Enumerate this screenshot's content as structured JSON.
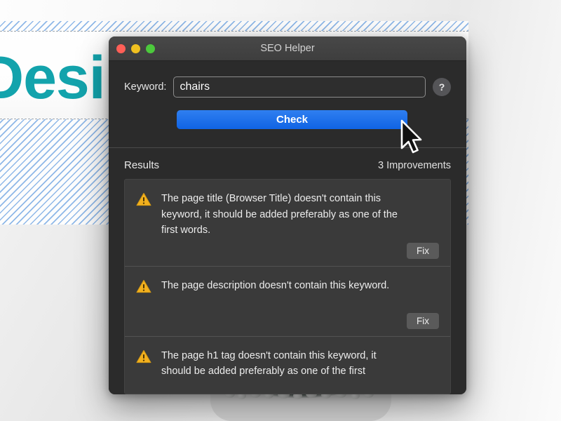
{
  "background": {
    "hero_text": "Desi",
    "brand_color": "#13a3ac",
    "stripe_color": "#8fb8e8"
  },
  "window": {
    "title": "SEO Helper",
    "traffic_lights": [
      {
        "name": "close",
        "color": "#ff5f57"
      },
      {
        "name": "minimize",
        "color": "#f0c020"
      },
      {
        "name": "zoom",
        "color": "#4cc93c"
      }
    ]
  },
  "form": {
    "keyword_label": "Keyword:",
    "keyword_value": "chairs",
    "keyword_placeholder": "",
    "help_label": "?",
    "check_label": "Check",
    "check_color": "#1a6fe8"
  },
  "results": {
    "title": "Results",
    "count_label": "3 Improvements",
    "fix_label": "Fix",
    "items": [
      {
        "icon": "warning-icon",
        "text": "The page title (Browser Title) doesn't contain this keyword, it should be added preferably as one of the first words.",
        "fix_label": "Fix",
        "has_fix": true
      },
      {
        "icon": "warning-icon",
        "text": "The page description doesn't contain this keyword.",
        "fix_label": "Fix",
        "has_fix": true
      },
      {
        "icon": "warning-icon",
        "text": "The page h1 tag doesn't contain this keyword, it should be added preferably as one of the first",
        "fix_label": "Fix",
        "has_fix": false
      }
    ]
  }
}
